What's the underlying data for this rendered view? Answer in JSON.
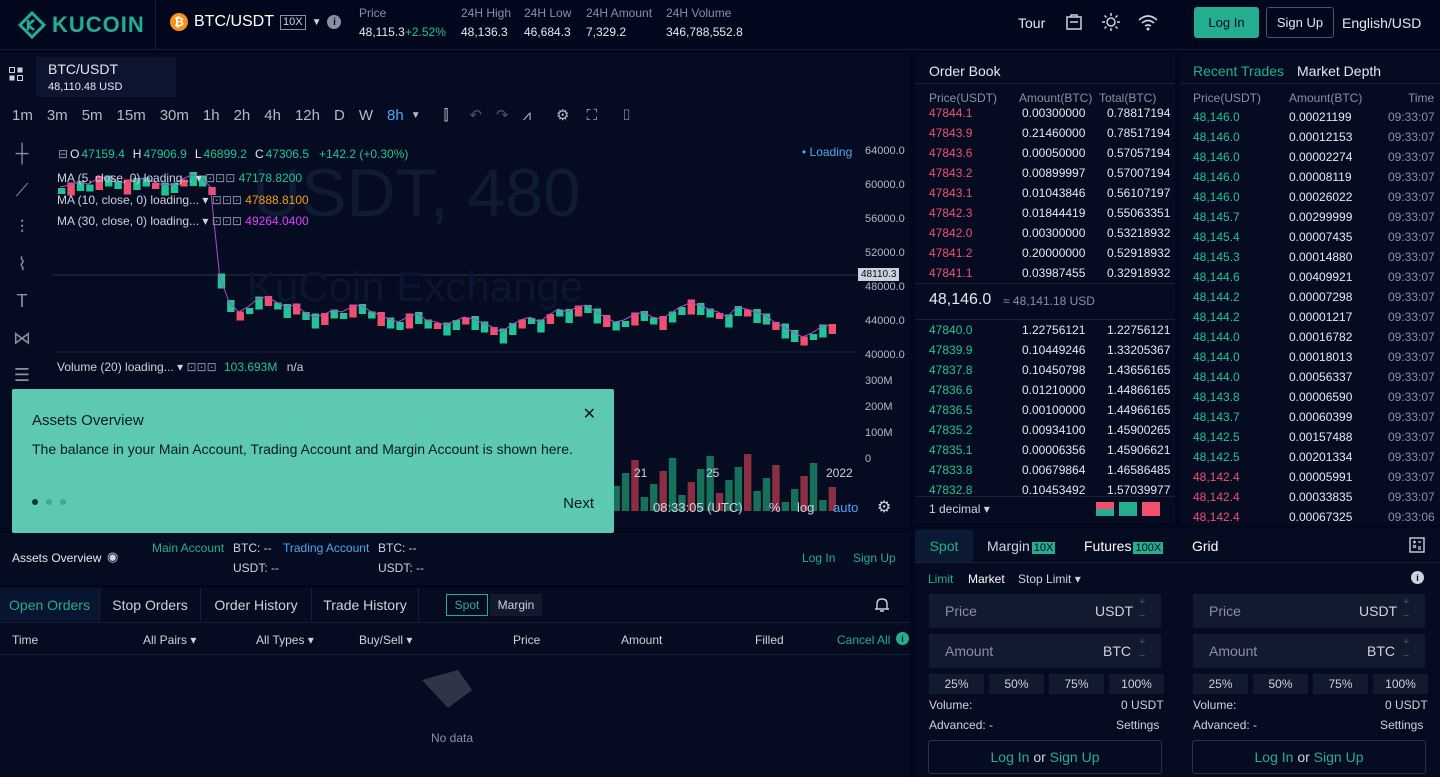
{
  "header": {
    "brand": "KUCOIN",
    "pair": "BTC/USDT",
    "leverage": "10X",
    "stats": [
      {
        "label": "Price",
        "value": "48,115.3",
        "change": "+2.52%"
      },
      {
        "label": "24H High",
        "value": "48,136.3"
      },
      {
        "label": "24H Low",
        "value": "46,684.3"
      },
      {
        "label": "24H Amount",
        "value": "7,329.2"
      },
      {
        "label": "24H Volume",
        "value": "346,788,552.8"
      }
    ],
    "tour": "Tour",
    "login": "Log In",
    "signup": "Sign Up",
    "lang": "English/USD"
  },
  "chart": {
    "symbol": "BTC/USDT",
    "price_usd": "48,110.48 USD",
    "timeframes": [
      "1m",
      "3m",
      "5m",
      "15m",
      "30m",
      "1h",
      "2h",
      "4h",
      "12h",
      "D",
      "W",
      "8h"
    ],
    "active_timeframe": "8h",
    "ohlc": {
      "o": "47159.4",
      "h": "47906.9",
      "l": "46899.2",
      "c": "47306.5",
      "chg": "+142.2 (+0.30%)"
    },
    "loading": "• Loading",
    "ma": [
      {
        "label": "MA (5, close, 0) loading...",
        "value": "47178.8200",
        "color": "#21c397"
      },
      {
        "label": "MA (10, close, 0) loading...",
        "value": "47888.8100",
        "color": "#f39c12"
      },
      {
        "label": "MA (30, close, 0) loading...",
        "value": "49264.0400",
        "color": "#e040fb"
      }
    ],
    "yaxis": [
      "64000.0",
      "60000.0",
      "56000.0",
      "52000.0",
      "48000.0",
      "44000.0",
      "40000.0"
    ],
    "current_price": "48110.3",
    "volume": {
      "label": "Volume (20) loading...",
      "value": "103.693M",
      "na": "n/a",
      "axis": [
        "300M",
        "200M",
        "100M",
        "0"
      ]
    },
    "xaxis": [
      "21",
      "25",
      "2022"
    ],
    "time": "08:33:05 (UTC)",
    "bottom_opts": [
      "%",
      "log",
      "auto"
    ]
  },
  "modal": {
    "title": "Assets Overview",
    "desc": "The balance in your Main Account, Trading Account and Margin Account is shown here.",
    "next": "Next"
  },
  "assets": {
    "label": "Assets Overview",
    "main": "Main Account",
    "trading": "Trading Account",
    "btc": "BTC: --",
    "usdt": "USDT: --",
    "login": "Log In",
    "signup": "Sign Up"
  },
  "orders": {
    "tabs": [
      "Open Orders",
      "Stop Orders",
      "Order History",
      "Trade History"
    ],
    "subtabs": [
      "Spot",
      "Margin"
    ],
    "cols": [
      "Time",
      "All Pairs",
      "All Types",
      "Buy/Sell",
      "Price",
      "Amount",
      "Filled",
      "Cancel All"
    ],
    "empty": "No data"
  },
  "orderbook": {
    "title": "Order Book",
    "cols": [
      "Price(USDT)",
      "Amount(BTC)",
      "Total(BTC)"
    ],
    "asks": [
      [
        "47844.1",
        "0.00300000",
        "0.78817194"
      ],
      [
        "47843.9",
        "0.21460000",
        "0.78517194"
      ],
      [
        "47843.6",
        "0.00050000",
        "0.57057194"
      ],
      [
        "47843.2",
        "0.00899997",
        "0.57007194"
      ],
      [
        "47843.1",
        "0.01043846",
        "0.56107197"
      ],
      [
        "47842.3",
        "0.01844419",
        "0.55063351"
      ],
      [
        "47842.0",
        "0.00300000",
        "0.53218932"
      ],
      [
        "47841.2",
        "0.20000000",
        "0.52918932"
      ],
      [
        "47841.1",
        "0.03987455",
        "0.32918932"
      ]
    ],
    "mid": "48,146.0",
    "mid_usd": "≈ 48,141.18 USD",
    "bids": [
      [
        "47840.0",
        "1.22756121",
        "1.22756121"
      ],
      [
        "47839.9",
        "0.10449246",
        "1.33205367"
      ],
      [
        "47837.8",
        "0.10450798",
        "1.43656165"
      ],
      [
        "47836.6",
        "0.01210000",
        "1.44866165"
      ],
      [
        "47836.5",
        "0.00100000",
        "1.44966165"
      ],
      [
        "47835.2",
        "0.00934100",
        "1.45900265"
      ],
      [
        "47835.1",
        "0.00006356",
        "1.45906621"
      ],
      [
        "47833.8",
        "0.00679864",
        "1.46586485"
      ],
      [
        "47832.8",
        "0.10453492",
        "1.57039977"
      ]
    ],
    "decimal": "1 decimal"
  },
  "trades": {
    "tabs": [
      "Recent Trades",
      "Market Depth"
    ],
    "cols": [
      "Price(USDT)",
      "Amount(BTC)",
      "Time"
    ],
    "rows": [
      [
        "48,146.0",
        "0.00021199",
        "09:33:07",
        "g"
      ],
      [
        "48,146.0",
        "0.00012153",
        "09:33:07",
        "g"
      ],
      [
        "48,146.0",
        "0.00002274",
        "09:33:07",
        "g"
      ],
      [
        "48,146.0",
        "0.00008119",
        "09:33:07",
        "g"
      ],
      [
        "48,146.0",
        "0.00026022",
        "09:33:07",
        "g"
      ],
      [
        "48,145.7",
        "0.00299999",
        "09:33:07",
        "g"
      ],
      [
        "48,145.4",
        "0.00007435",
        "09:33:07",
        "g"
      ],
      [
        "48,145.3",
        "0.00014880",
        "09:33:07",
        "g"
      ],
      [
        "48,144.6",
        "0.00409921",
        "09:33:07",
        "g"
      ],
      [
        "48,144.2",
        "0.00007298",
        "09:33:07",
        "g"
      ],
      [
        "48,144.2",
        "0.00001217",
        "09:33:07",
        "g"
      ],
      [
        "48,144.0",
        "0.00016782",
        "09:33:07",
        "g"
      ],
      [
        "48,144.0",
        "0.00018013",
        "09:33:07",
        "g"
      ],
      [
        "48,144.0",
        "0.00056337",
        "09:33:07",
        "g"
      ],
      [
        "48,143.8",
        "0.00006590",
        "09:33:07",
        "g"
      ],
      [
        "48,143.7",
        "0.00060399",
        "09:33:07",
        "g"
      ],
      [
        "48,142.5",
        "0.00157488",
        "09:33:07",
        "g"
      ],
      [
        "48,142.5",
        "0.00201334",
        "09:33:07",
        "g"
      ],
      [
        "48,142.4",
        "0.00005991",
        "09:33:07",
        "r"
      ],
      [
        "48,142.4",
        "0.00033835",
        "09:33:07",
        "r"
      ],
      [
        "48,142.4",
        "0.00067325",
        "09:33:06",
        "r"
      ]
    ]
  },
  "form": {
    "tabs": [
      {
        "label": "Spot"
      },
      {
        "label": "Margin",
        "badge": "10X"
      },
      {
        "label": "Futures",
        "badge": "100X"
      },
      {
        "label": "Grid"
      }
    ],
    "types": [
      "Limit",
      "Market",
      "Stop Limit"
    ],
    "price": "Price",
    "price_unit": "USDT",
    "amount": "Amount",
    "amount_unit": "BTC",
    "pcts": [
      "25%",
      "50%",
      "75%",
      "100%"
    ],
    "volume_label": "Volume:",
    "volume_val": "0 USDT",
    "advanced": "Advanced: -",
    "settings": "Settings",
    "login": "Log In",
    "or": "or",
    "signup": "Sign Up"
  }
}
